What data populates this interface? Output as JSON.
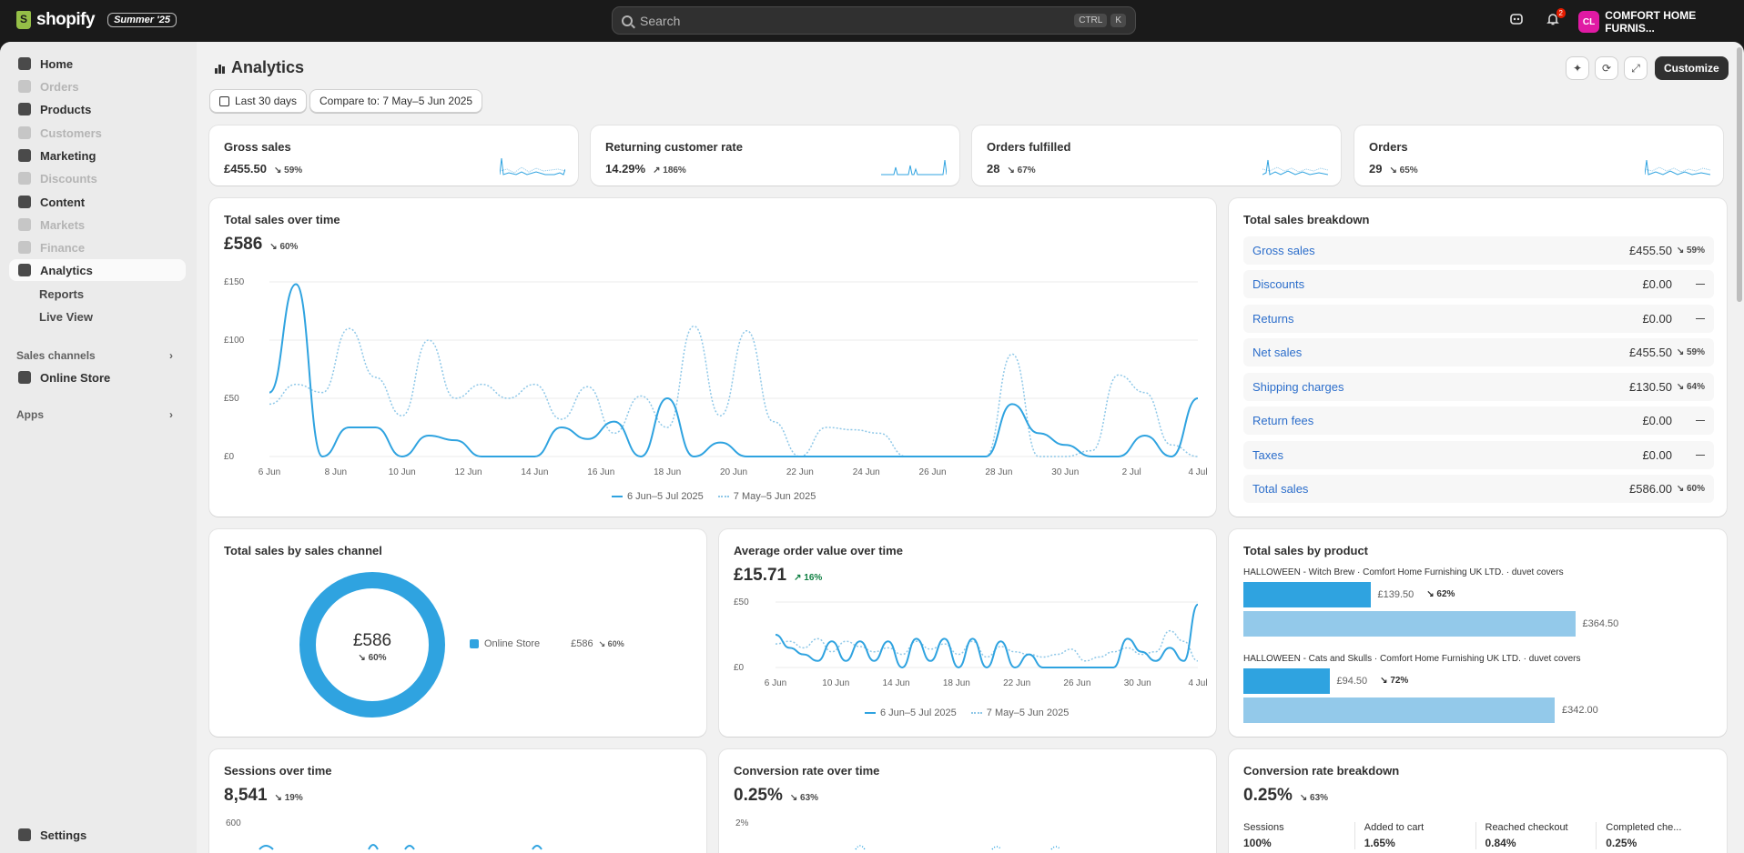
{
  "topbar": {
    "brand": "shopify",
    "edition": "Summer '25",
    "search_placeholder": "Search",
    "shortcut": [
      "CTRL",
      "K"
    ],
    "notification_count": "2",
    "store_initials": "CL",
    "store_name": "COMFORT HOME FURNIS..."
  },
  "sidebar": {
    "items": [
      {
        "label": "Home",
        "disabled": false
      },
      {
        "label": "Orders",
        "disabled": true
      },
      {
        "label": "Products",
        "disabled": false
      },
      {
        "label": "Customers",
        "disabled": true
      },
      {
        "label": "Marketing",
        "disabled": false
      },
      {
        "label": "Discounts",
        "disabled": true
      },
      {
        "label": "Content",
        "disabled": false
      },
      {
        "label": "Markets",
        "disabled": true
      },
      {
        "label": "Finance",
        "disabled": true
      },
      {
        "label": "Analytics",
        "disabled": false
      }
    ],
    "sub_items": [
      "Reports",
      "Live View"
    ],
    "sales_channels_label": "Sales channels",
    "online_store": "Online Store",
    "apps_label": "Apps",
    "settings": "Settings"
  },
  "page": {
    "title": "Analytics",
    "date_range": "Last 30 days",
    "compare": "Compare to: 7 May–5 Jun 2025",
    "customize": "Customize"
  },
  "kpis": [
    {
      "label": "Gross sales",
      "value": "£455.50",
      "delta": "↘ 59%"
    },
    {
      "label": "Returning customer rate",
      "value": "14.29%",
      "delta": "↗ 186%"
    },
    {
      "label": "Orders fulfilled",
      "value": "28",
      "delta": "↘ 67%"
    },
    {
      "label": "Orders",
      "value": "29",
      "delta": "↘ 65%"
    }
  ],
  "total_sales": {
    "title": "Total sales over time",
    "value": "£586",
    "delta": "↘ 60%",
    "legend_current": "6 Jun–5 Jul 2025",
    "legend_previous": "7 May–5 Jun 2025"
  },
  "breakdown": {
    "title": "Total sales breakdown",
    "rows": [
      {
        "label": "Gross sales",
        "amount": "£455.50",
        "change": "↘ 59%"
      },
      {
        "label": "Discounts",
        "amount": "£0.00",
        "change": "—"
      },
      {
        "label": "Returns",
        "amount": "£0.00",
        "change": "—"
      },
      {
        "label": "Net sales",
        "amount": "£455.50",
        "change": "↘ 59%"
      },
      {
        "label": "Shipping charges",
        "amount": "£130.50",
        "change": "↘ 64%"
      },
      {
        "label": "Return fees",
        "amount": "£0.00",
        "change": "—"
      },
      {
        "label": "Taxes",
        "amount": "£0.00",
        "change": "—"
      },
      {
        "label": "Total sales",
        "amount": "£586.00",
        "change": "↘ 60%"
      }
    ]
  },
  "by_channel": {
    "title": "Total sales by sales channel",
    "center_value": "£586",
    "center_delta": "↘ 60%",
    "channel": "Online Store",
    "channel_value": "£586",
    "channel_delta": "↘ 60%",
    "color": "#2fa3e0"
  },
  "aov": {
    "title": "Average order value over time",
    "value": "£15.71",
    "delta": "↗ 16%",
    "legend_current": "6 Jun–5 Jul 2025",
    "legend_previous": "7 May–5 Jun 2025"
  },
  "by_product": {
    "title": "Total sales by product",
    "products": [
      {
        "name": "HALLOWEEN - Witch Brew · Comfort Home Furnishing UK LTD. · duvet covers",
        "current": "£139.50",
        "delta": "↘ 62%",
        "previous": "£364.50",
        "current_num": 139.5,
        "previous_num": 364.5
      },
      {
        "name": "HALLOWEEN - Cats and Skulls · Comfort Home Furnishing UK LTD. · duvet covers",
        "current": "£94.50",
        "delta": "↘ 72%",
        "previous": "£342.00",
        "current_num": 94.5,
        "previous_num": 342
      }
    ]
  },
  "sessions": {
    "title": "Sessions over time",
    "value": "8,541",
    "delta": "↘ 19%",
    "ytick": "600"
  },
  "conversion": {
    "title": "Conversion rate over time",
    "value": "0.25%",
    "delta": "↘ 63%",
    "ytick": "2%"
  },
  "conversion_breakdown": {
    "title": "Conversion rate breakdown",
    "value": "0.25%",
    "delta": "↘ 63%",
    "steps": [
      {
        "label": "Sessions",
        "value": "100%"
      },
      {
        "label": "Added to cart",
        "value": "1.65%"
      },
      {
        "label": "Reached checkout",
        "value": "0.84%"
      },
      {
        "label": "Completed che...",
        "value": "0.25%"
      }
    ]
  },
  "chart_data": [
    {
      "type": "line",
      "title": "Total sales over time",
      "ylim": [
        0,
        150
      ],
      "yticks": [
        "£150",
        "£100",
        "£50",
        "£0"
      ],
      "x_labels": [
        "6 Jun",
        "8 Jun",
        "10 Jun",
        "12 Jun",
        "14 Jun",
        "16 Jun",
        "18 Jun",
        "20 Jun",
        "22 Jun",
        "24 Jun",
        "26 Jun",
        "28 Jun",
        "30 Jun",
        "2 Jul",
        "4 Jul"
      ],
      "series": [
        {
          "name": "6 Jun–5 Jul 2025",
          "values": [
            55,
            148,
            0,
            25,
            25,
            0,
            18,
            14,
            0,
            0,
            0,
            25,
            15,
            30,
            0,
            50,
            0,
            12,
            0,
            0,
            0,
            0,
            0,
            0,
            0,
            0,
            0,
            0,
            45,
            20,
            10,
            0,
            0,
            18,
            0,
            50
          ]
        },
        {
          "name": "7 May–5 Jun 2025",
          "values": [
            45,
            62,
            55,
            110,
            68,
            35,
            100,
            50,
            62,
            50,
            62,
            32,
            60,
            20,
            52,
            25,
            112,
            35,
            108,
            30,
            0,
            25,
            23,
            20,
            0,
            0,
            0,
            0,
            88,
            0,
            0,
            5,
            70,
            55,
            10,
            0
          ]
        }
      ]
    },
    {
      "type": "pie",
      "title": "Total sales by sales channel",
      "categories": [
        "Online Store"
      ],
      "values": [
        586
      ]
    },
    {
      "type": "line",
      "title": "Average order value over time",
      "ylim": [
        0,
        50
      ],
      "yticks": [
        "£50",
        "£0"
      ],
      "x_labels": [
        "6 Jun",
        "10 Jun",
        "14 Jun",
        "18 Jun",
        "22 Jun",
        "26 Jun",
        "30 Jun",
        "4 Jul"
      ],
      "series": [
        {
          "name": "6 Jun–5 Jul 2025",
          "values": [
            25,
            15,
            10,
            5,
            20,
            5,
            20,
            5,
            20,
            0,
            22,
            5,
            22,
            0,
            22,
            0,
            20,
            0,
            10,
            0,
            0,
            0,
            0,
            0,
            0,
            22,
            12,
            5,
            15,
            5,
            48
          ]
        },
        {
          "name": "7 May–5 Jun 2025",
          "values": [
            18,
            20,
            15,
            22,
            12,
            20,
            16,
            12,
            15,
            10,
            20,
            14,
            18,
            10,
            20,
            8,
            16,
            12,
            10,
            8,
            10,
            14,
            5,
            8,
            12,
            15,
            10,
            12,
            28,
            20,
            5
          ]
        }
      ]
    },
    {
      "type": "bar",
      "title": "Total sales by product",
      "categories": [
        "HALLOWEEN - Witch Brew",
        "HALLOWEEN - Cats and Skulls"
      ],
      "series": [
        {
          "name": "6 Jun–5 Jul 2025",
          "values": [
            139.5,
            94.5
          ]
        },
        {
          "name": "7 May–5 Jun 2025",
          "values": [
            364.5,
            342.0
          ]
        }
      ]
    }
  ]
}
